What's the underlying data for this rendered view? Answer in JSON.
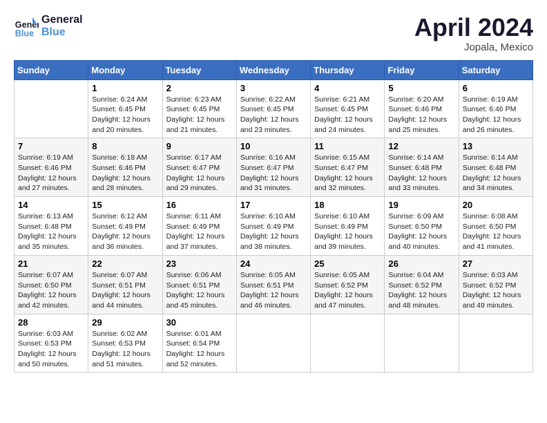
{
  "header": {
    "logo_line1": "General",
    "logo_line2": "Blue",
    "month": "April 2024",
    "location": "Jopala, Mexico"
  },
  "weekdays": [
    "Sunday",
    "Monday",
    "Tuesday",
    "Wednesday",
    "Thursday",
    "Friday",
    "Saturday"
  ],
  "weeks": [
    [
      {
        "day": "",
        "info": ""
      },
      {
        "day": "1",
        "info": "Sunrise: 6:24 AM\nSunset: 6:45 PM\nDaylight: 12 hours\nand 20 minutes."
      },
      {
        "day": "2",
        "info": "Sunrise: 6:23 AM\nSunset: 6:45 PM\nDaylight: 12 hours\nand 21 minutes."
      },
      {
        "day": "3",
        "info": "Sunrise: 6:22 AM\nSunset: 6:45 PM\nDaylight: 12 hours\nand 23 minutes."
      },
      {
        "day": "4",
        "info": "Sunrise: 6:21 AM\nSunset: 6:45 PM\nDaylight: 12 hours\nand 24 minutes."
      },
      {
        "day": "5",
        "info": "Sunrise: 6:20 AM\nSunset: 6:46 PM\nDaylight: 12 hours\nand 25 minutes."
      },
      {
        "day": "6",
        "info": "Sunrise: 6:19 AM\nSunset: 6:46 PM\nDaylight: 12 hours\nand 26 minutes."
      }
    ],
    [
      {
        "day": "7",
        "info": "Sunrise: 6:19 AM\nSunset: 6:46 PM\nDaylight: 12 hours\nand 27 minutes."
      },
      {
        "day": "8",
        "info": "Sunrise: 6:18 AM\nSunset: 6:46 PM\nDaylight: 12 hours\nand 28 minutes."
      },
      {
        "day": "9",
        "info": "Sunrise: 6:17 AM\nSunset: 6:47 PM\nDaylight: 12 hours\nand 29 minutes."
      },
      {
        "day": "10",
        "info": "Sunrise: 6:16 AM\nSunset: 6:47 PM\nDaylight: 12 hours\nand 31 minutes."
      },
      {
        "day": "11",
        "info": "Sunrise: 6:15 AM\nSunset: 6:47 PM\nDaylight: 12 hours\nand 32 minutes."
      },
      {
        "day": "12",
        "info": "Sunrise: 6:14 AM\nSunset: 6:48 PM\nDaylight: 12 hours\nand 33 minutes."
      },
      {
        "day": "13",
        "info": "Sunrise: 6:14 AM\nSunset: 6:48 PM\nDaylight: 12 hours\nand 34 minutes."
      }
    ],
    [
      {
        "day": "14",
        "info": "Sunrise: 6:13 AM\nSunset: 6:48 PM\nDaylight: 12 hours\nand 35 minutes."
      },
      {
        "day": "15",
        "info": "Sunrise: 6:12 AM\nSunset: 6:49 PM\nDaylight: 12 hours\nand 36 minutes."
      },
      {
        "day": "16",
        "info": "Sunrise: 6:11 AM\nSunset: 6:49 PM\nDaylight: 12 hours\nand 37 minutes."
      },
      {
        "day": "17",
        "info": "Sunrise: 6:10 AM\nSunset: 6:49 PM\nDaylight: 12 hours\nand 38 minutes."
      },
      {
        "day": "18",
        "info": "Sunrise: 6:10 AM\nSunset: 6:49 PM\nDaylight: 12 hours\nand 39 minutes."
      },
      {
        "day": "19",
        "info": "Sunrise: 6:09 AM\nSunset: 6:50 PM\nDaylight: 12 hours\nand 40 minutes."
      },
      {
        "day": "20",
        "info": "Sunrise: 6:08 AM\nSunset: 6:50 PM\nDaylight: 12 hours\nand 41 minutes."
      }
    ],
    [
      {
        "day": "21",
        "info": "Sunrise: 6:07 AM\nSunset: 6:50 PM\nDaylight: 12 hours\nand 42 minutes."
      },
      {
        "day": "22",
        "info": "Sunrise: 6:07 AM\nSunset: 6:51 PM\nDaylight: 12 hours\nand 44 minutes."
      },
      {
        "day": "23",
        "info": "Sunrise: 6:06 AM\nSunset: 6:51 PM\nDaylight: 12 hours\nand 45 minutes."
      },
      {
        "day": "24",
        "info": "Sunrise: 6:05 AM\nSunset: 6:51 PM\nDaylight: 12 hours\nand 46 minutes."
      },
      {
        "day": "25",
        "info": "Sunrise: 6:05 AM\nSunset: 6:52 PM\nDaylight: 12 hours\nand 47 minutes."
      },
      {
        "day": "26",
        "info": "Sunrise: 6:04 AM\nSunset: 6:52 PM\nDaylight: 12 hours\nand 48 minutes."
      },
      {
        "day": "27",
        "info": "Sunrise: 6:03 AM\nSunset: 6:52 PM\nDaylight: 12 hours\nand 49 minutes."
      }
    ],
    [
      {
        "day": "28",
        "info": "Sunrise: 6:03 AM\nSunset: 6:53 PM\nDaylight: 12 hours\nand 50 minutes."
      },
      {
        "day": "29",
        "info": "Sunrise: 6:02 AM\nSunset: 6:53 PM\nDaylight: 12 hours\nand 51 minutes."
      },
      {
        "day": "30",
        "info": "Sunrise: 6:01 AM\nSunset: 6:54 PM\nDaylight: 12 hours\nand 52 minutes."
      },
      {
        "day": "",
        "info": ""
      },
      {
        "day": "",
        "info": ""
      },
      {
        "day": "",
        "info": ""
      },
      {
        "day": "",
        "info": ""
      }
    ]
  ]
}
